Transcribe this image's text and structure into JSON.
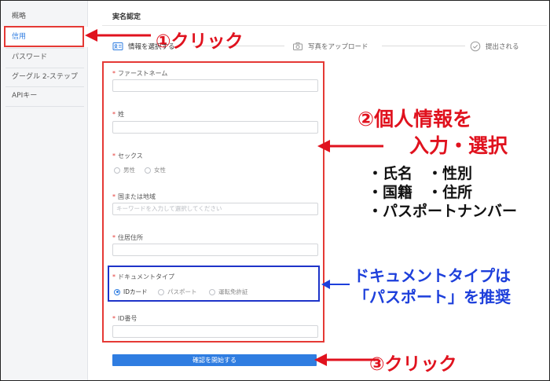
{
  "sidebar": {
    "items": [
      {
        "label": "概略"
      },
      {
        "label": "信用"
      },
      {
        "label": "パスワード"
      },
      {
        "label": "グーグル 2-ステップ"
      },
      {
        "label": "APIキー"
      }
    ],
    "active_index": 1
  },
  "header": {
    "title": "実名認定"
  },
  "steps": [
    {
      "label": "情報を選択する"
    },
    {
      "label": "写真をアップロード"
    },
    {
      "label": "提出される"
    }
  ],
  "form": {
    "first_name_label": "ファーストネーム",
    "last_name_label": "姓",
    "sex_label": "セックス",
    "sex_options": [
      "男性",
      "女性"
    ],
    "country_label": "国または地域",
    "country_placeholder": "キーワードを入力して選択してください",
    "address_label": "住居住所",
    "doc_type_label": "ドキュメントタイプ",
    "doc_type_options": [
      "IDカード",
      "パスポート",
      "運転免許証"
    ],
    "doc_type_selected": "IDカード",
    "id_number_label": "ID番号",
    "start_button": "確認を開始する"
  },
  "annotations": {
    "step1": "①クリック",
    "step2_line1": "②個人情報を",
    "step2_line2": "入力・選択",
    "fields_line1": "・氏名　・性別",
    "fields_line2": "・国籍　・住所",
    "fields_line3": "・パスポートナンバー",
    "doc_note_line1": "ドキュメントタイプは",
    "doc_note_line2": "「パスポート」を推奨",
    "step3": "③クリック"
  },
  "colors": {
    "accent": "#2f7de1",
    "annotation_red": "#e0121e",
    "annotation_blue": "#1d3fdb"
  }
}
